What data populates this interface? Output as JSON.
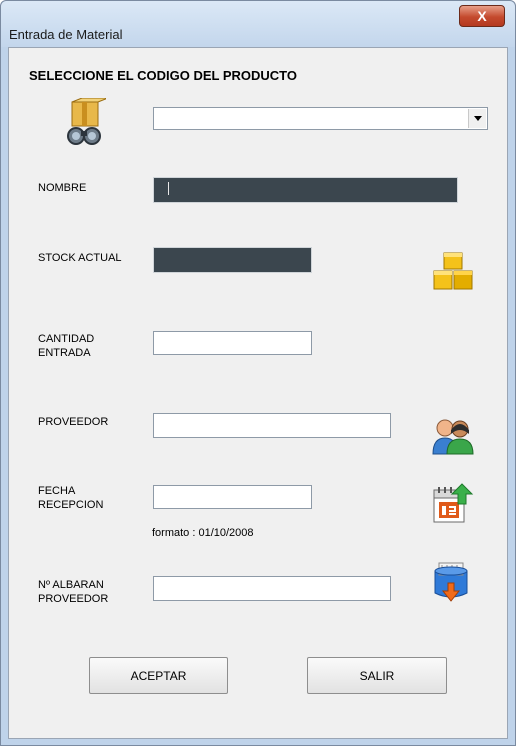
{
  "window": {
    "title": "Entrada de Material",
    "close_label": "X"
  },
  "form": {
    "heading": "SELECCIONE EL CODIGO DEL PRODUCTO",
    "codigo": {
      "value": ""
    },
    "nombre": {
      "label": "NOMBRE",
      "value": ""
    },
    "stock": {
      "label": "STOCK ACTUAL",
      "value": ""
    },
    "cantidad": {
      "label_line1": "CANTIDAD",
      "label_line2": "ENTRADA",
      "value": ""
    },
    "proveedor": {
      "label": "PROVEEDOR",
      "value": ""
    },
    "fecha": {
      "label_line1": "FECHA",
      "label_line2": "RECEPCION",
      "value": "",
      "hint": "formato : 01/10/2008"
    },
    "albaran": {
      "label_line1": "Nº ALBARAN",
      "label_line2": "PROVEEDOR",
      "value": ""
    }
  },
  "buttons": {
    "accept": "ACEPTAR",
    "exit": "SALIR"
  },
  "icons": {
    "search": "box-binoculars-icon",
    "stock": "boxes-icon",
    "supplier": "users-icon",
    "calendar": "calendar-icon",
    "delivery": "delivery-box-icon"
  },
  "colors": {
    "readonly_field": "#3b464e",
    "close_button": "#c44a2e"
  }
}
